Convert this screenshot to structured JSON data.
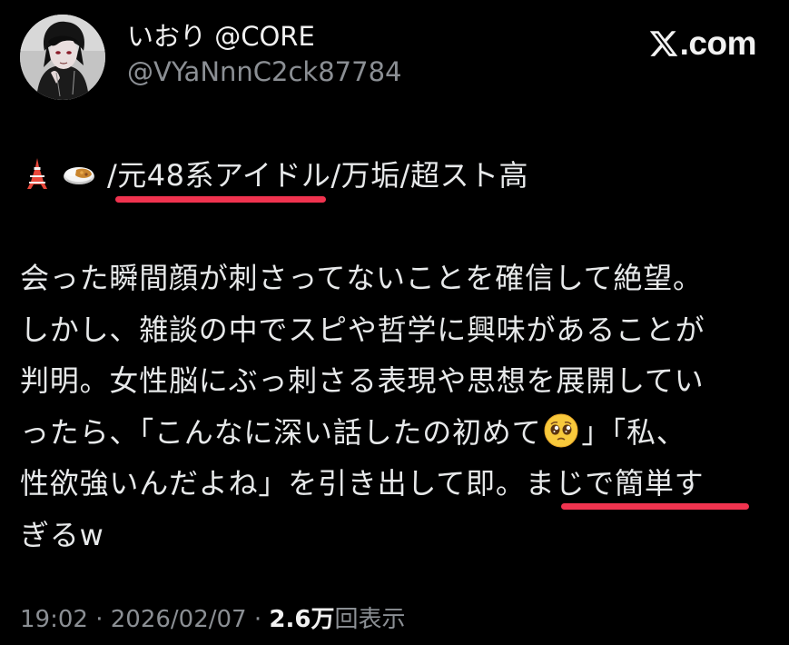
{
  "tweet": {
    "author": {
      "display_name": "いおり @CORE",
      "handle": "@VYaNnnC2ck87784"
    },
    "brand": {
      "text": ".com"
    },
    "bio": {
      "text": "/元48系アイドル/万垢/超スト高",
      "emojis": [
        "tokyo-tower",
        "curry-rice"
      ]
    },
    "body_lines": [
      "会った瞬間顔が刺さってないことを確信して絶望。",
      "しかし、雑談の中でスピや哲学に興味があることが",
      "判明。女性脳にぶっ刺さる表現や思想を展開してい",
      "ったら、「こんなに深い話したの初めて",
      "」「私、",
      "性欲強いんだよね」を引き出して即。まじで簡単す",
      "ぎるw"
    ],
    "inline_emoji": "pleading-face",
    "meta": {
      "time": "19:02",
      "separator_1": " · ",
      "date": "2026/02/07",
      "separator_2": " · ",
      "views_count": "2.6万",
      "views_label": "回表示"
    },
    "highlight_color": "#f0334f"
  }
}
